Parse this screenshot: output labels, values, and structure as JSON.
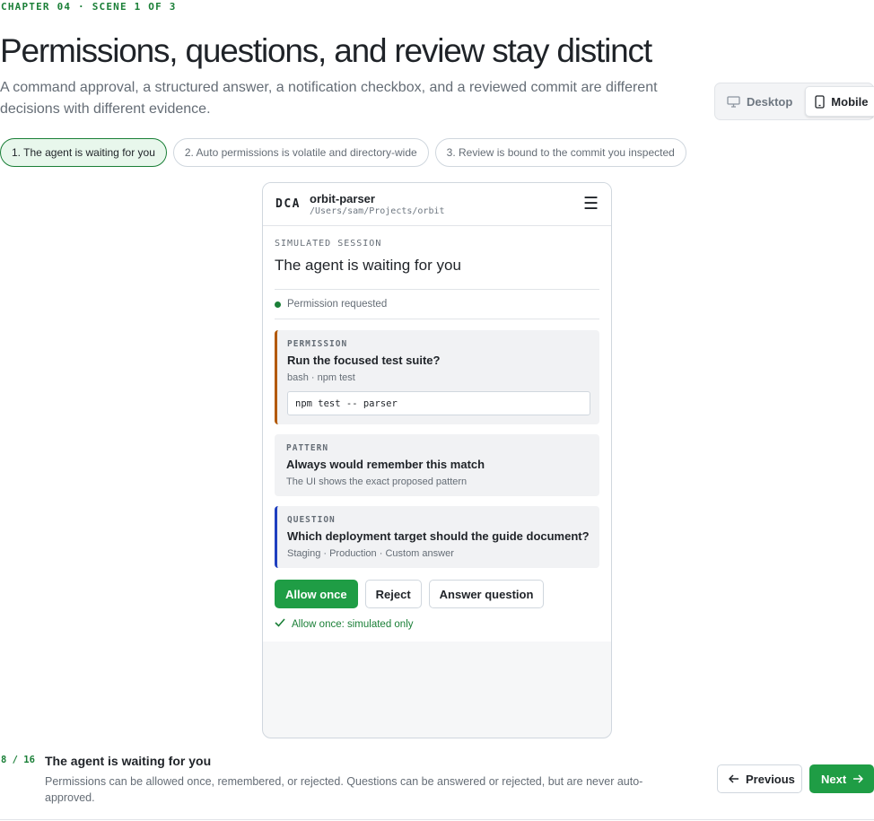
{
  "chapter_label": "CHAPTER 04 · SCENE 1 OF 3",
  "page_title": "Permissions, questions, and review stay distinct",
  "subtitle": "A command approval, a structured answer, a notification checkbox, and a reviewed commit are different decisions with different evidence.",
  "view_toggle": {
    "desktop_label": "Desktop",
    "mobile_label": "Mobile",
    "selected": "Mobile"
  },
  "scene_tabs": [
    {
      "label": "1. The agent is waiting for you",
      "active": true
    },
    {
      "label": "2. Auto permissions is volatile and directory-wide",
      "active": false
    },
    {
      "label": "3. Review is bound to the commit you inspected",
      "active": false
    }
  ],
  "phone": {
    "logo": "DCA",
    "project_name": "orbit-parser",
    "project_path": "/Users/sam/Projects/orbit",
    "session_label": "SIMULATED SESSION",
    "session_title": "The agent is waiting for you",
    "status_text": "Permission requested",
    "permission_card": {
      "kicker": "PERMISSION",
      "title": "Run the focused test suite?",
      "meta": "bash · npm test",
      "command": "npm test -- parser"
    },
    "pattern_card": {
      "kicker": "PATTERN",
      "title": "Always would remember this match",
      "meta": "The UI shows the exact proposed pattern"
    },
    "question_card": {
      "kicker": "QUESTION",
      "title": "Which deployment target should the guide document?",
      "meta": "Staging · Production · Custom answer"
    },
    "actions": {
      "allow_once": "Allow once",
      "reject": "Reject",
      "answer_question": "Answer question"
    },
    "confirmation": "Allow once: simulated only"
  },
  "footer": {
    "counter": "8 / 16",
    "title": "The agent is waiting for you",
    "description": "Permissions can be allowed once, remembered, or rejected. Questions can be answered or rejected, but are never auto-approved.",
    "previous_label": "Previous",
    "next_label": "Next"
  },
  "colors": {
    "accent_green": "#1f9d45",
    "permission_accent": "#b35900",
    "question_accent": "#1f3fbf"
  }
}
